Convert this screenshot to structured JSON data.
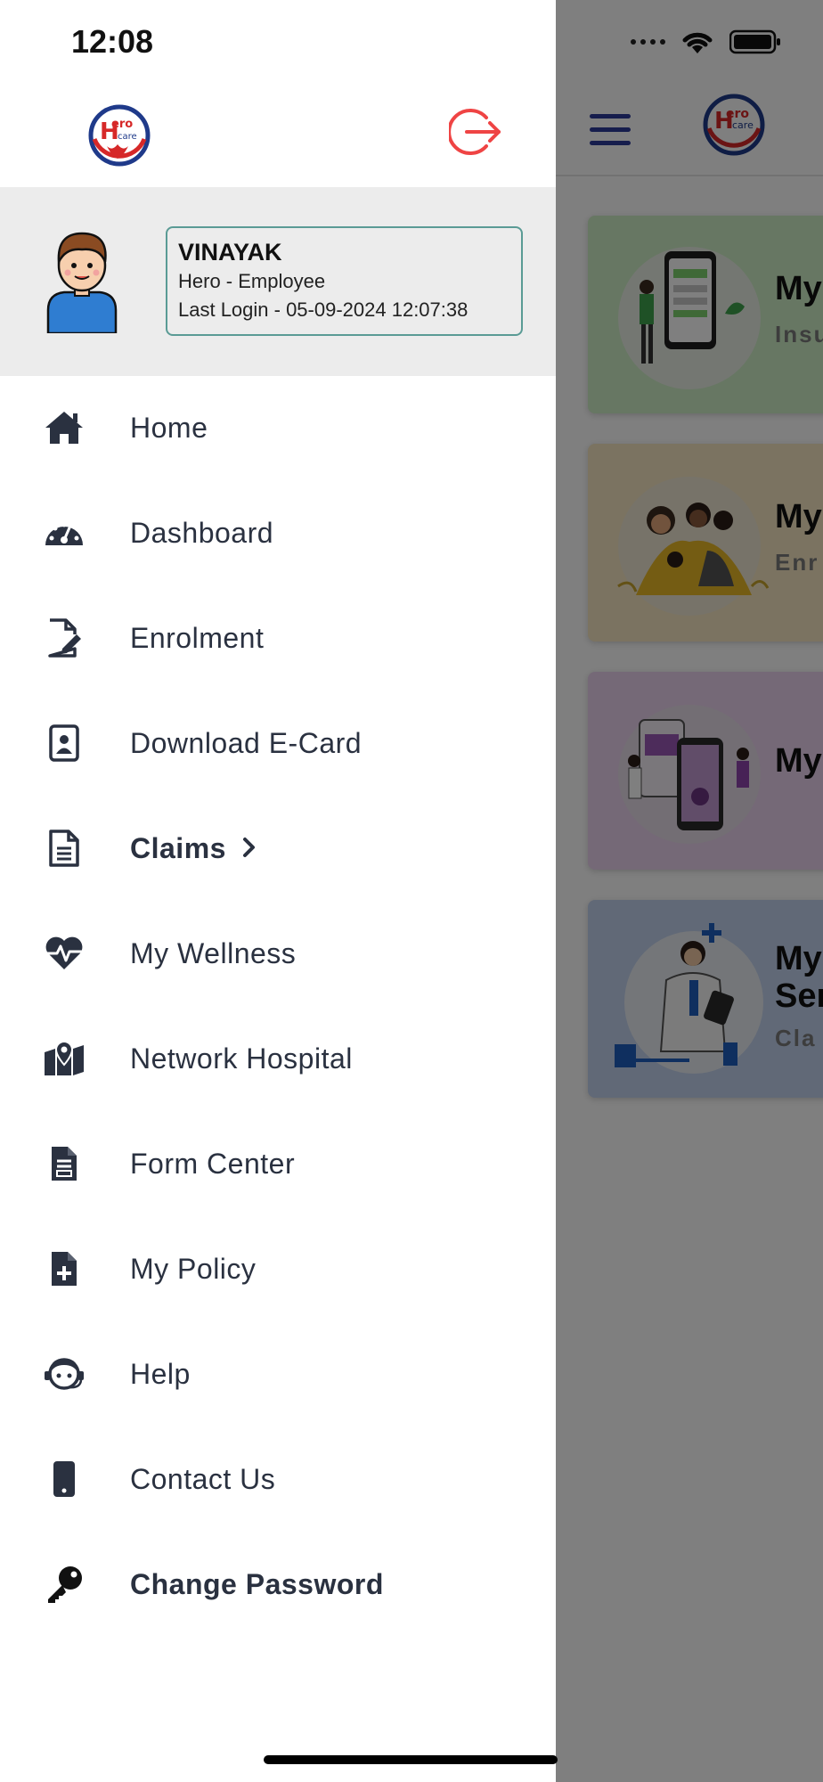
{
  "status_bar": {
    "time": "12:08"
  },
  "drawer": {
    "logo_text_top": "Hero",
    "logo_text_bottom": "care",
    "logout_icon": "logout-icon"
  },
  "profile": {
    "name": "VINAYAK",
    "role": "Hero - Employee",
    "last_login": "Last Login - 05-09-2024 12:07:38"
  },
  "menu": {
    "items": [
      {
        "label": "Home",
        "icon": "home-icon",
        "bold": false
      },
      {
        "label": "Dashboard",
        "icon": "dashboard-icon",
        "bold": false
      },
      {
        "label": "Enrolment",
        "icon": "enrolment-icon",
        "bold": false
      },
      {
        "label": "Download E-Card",
        "icon": "id-card-icon",
        "bold": false
      },
      {
        "label": "Claims",
        "icon": "document-icon",
        "bold": true,
        "has_chevron": true
      },
      {
        "label": "My Wellness",
        "icon": "heartbeat-icon",
        "bold": false
      },
      {
        "label": "Network Hospital",
        "icon": "map-marker-icon",
        "bold": false
      },
      {
        "label": "Form Center",
        "icon": "form-icon",
        "bold": false
      },
      {
        "label": "My Policy",
        "icon": "file-plus-icon",
        "bold": false
      },
      {
        "label": "Help",
        "icon": "help-face-icon",
        "bold": false
      },
      {
        "label": "Contact Us",
        "icon": "mobile-icon",
        "bold": false
      },
      {
        "label": "Change Password",
        "icon": "key-icon",
        "bold": true
      }
    ]
  },
  "background": {
    "cards": [
      {
        "title": "My",
        "subtitle": "Insu",
        "color": "#cfeec6"
      },
      {
        "title": "My",
        "subtitle": "Enr",
        "color": "#f6e7c2"
      },
      {
        "title": "My",
        "subtitle": "",
        "color": "#ead3ef"
      },
      {
        "title": "My",
        "title2": "Ser",
        "subtitle": "Cla",
        "color": "#c3d3ee"
      }
    ]
  },
  "colors": {
    "accent": "#ef4444",
    "brand_blue": "#2d3a9a",
    "profile_border": "#5a9b95"
  }
}
